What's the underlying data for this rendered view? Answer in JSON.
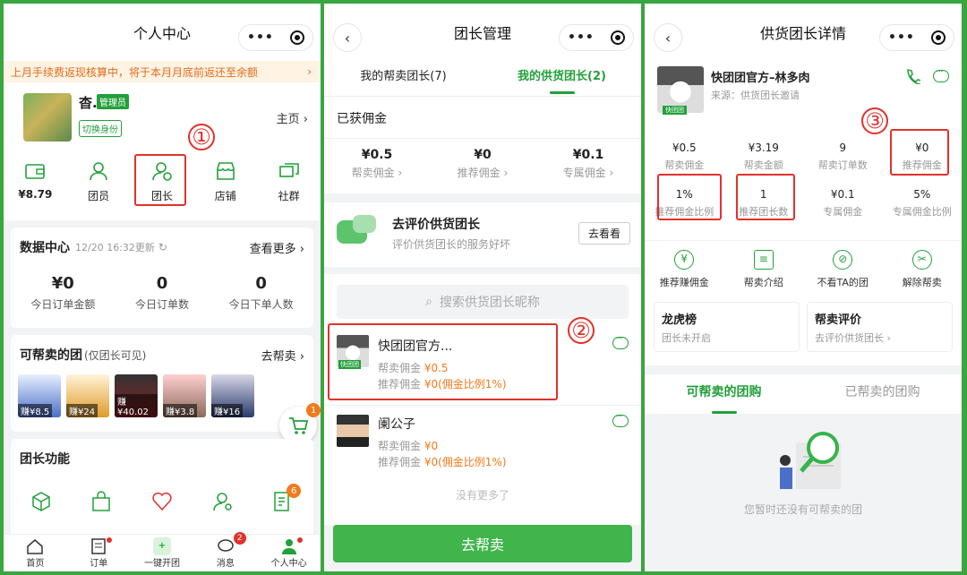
{
  "panel1": {
    "title": "个人中心",
    "notice": "上月手续费返现核算中，将于本月月底前返还至余额",
    "user": {
      "name": "杳.",
      "role": "管理员",
      "switch": "切换身份",
      "home": "主页"
    },
    "grid": [
      {
        "value": "¥8.79",
        "icon": "wallet-icon"
      },
      {
        "label": "团员",
        "icon": "person-icon"
      },
      {
        "label": "团长",
        "icon": "leader-icon"
      },
      {
        "label": "店铺",
        "icon": "shop-icon"
      },
      {
        "label": "社群",
        "icon": "group-chat-icon"
      }
    ],
    "marker": "①",
    "data_center": {
      "title": "数据中心",
      "updated": "12/20 16:32更新",
      "more": "查看更多",
      "stats": [
        {
          "value": "¥0",
          "label": "今日订单金额"
        },
        {
          "value": "0",
          "label": "今日订单数"
        },
        {
          "value": "0",
          "label": "今日下单人数"
        }
      ]
    },
    "helpsell": {
      "title": "可帮卖的团",
      "note": "(仅团长可见)",
      "link": "去帮卖",
      "goods": [
        "赚¥8.5",
        "赚¥24",
        "赚¥40.02",
        "赚¥3.8",
        "赚¥16"
      ],
      "cart_badge": "1"
    },
    "leader_funcs": {
      "title": "团长功能",
      "badge": "6"
    },
    "tabbar": [
      {
        "label": "首页"
      },
      {
        "label": "订单"
      },
      {
        "label": "一键开团"
      },
      {
        "label": "消息",
        "badge": "2"
      },
      {
        "label": "个人中心"
      }
    ]
  },
  "panel2": {
    "title": "团长管理",
    "tabs": [
      "我的帮卖团长(7)",
      "我的供货团长(2)"
    ],
    "earned_title": "已获佣金",
    "earned": [
      {
        "value": "¥0.5",
        "label": "帮卖佣金"
      },
      {
        "value": "¥0",
        "label": "推荐佣金"
      },
      {
        "value": "¥0.1",
        "label": "专属佣金"
      }
    ],
    "review": {
      "title": "去评价供货团长",
      "desc": "评价供货团长的服务好坏",
      "button": "去看看"
    },
    "search_placeholder": "搜索供货团长昵称",
    "leaders": [
      {
        "name": "快团团官方...",
        "badge": "快团团",
        "sell_label": "帮卖佣金",
        "sell": "¥0.5",
        "rec_label": "推荐佣金",
        "rec": "¥0(佣金比例1%)"
      },
      {
        "name": "阑公子",
        "sell_label": "帮卖佣金",
        "sell": "¥0",
        "rec_label": "推荐佣金",
        "rec": "¥0(佣金比例1%)"
      }
    ],
    "marker": "②",
    "no_more": "没有更多了",
    "main_button": "去帮卖"
  },
  "panel3": {
    "title": "供货团长详情",
    "leader": {
      "name": "快团团官方–林多肉",
      "source": "来源：供货团长邀请",
      "badge": "快团团"
    },
    "marker": "③",
    "stats": [
      {
        "value": "¥0.5",
        "label": "帮卖佣金"
      },
      {
        "value": "¥3.19",
        "label": "帮卖金额"
      },
      {
        "value": "9",
        "label": "帮卖订单数"
      },
      {
        "value": "¥0",
        "label": "推荐佣金"
      },
      {
        "value": "1%",
        "label": "推荐佣金比例"
      },
      {
        "value": "1",
        "label": "推荐团长数"
      },
      {
        "value": "¥0.1",
        "label": "专属佣金"
      },
      {
        "value": "5%",
        "label": "专属佣金比例"
      }
    ],
    "actions": [
      "推荐赚佣金",
      "帮卖介绍",
      "不看TA的团",
      "解除帮卖"
    ],
    "cards": [
      {
        "title": "龙虎榜",
        "desc": "团长未开启"
      },
      {
        "title": "帮卖评价",
        "desc": "去评价供货团长"
      }
    ],
    "tabs": [
      "可帮卖的团购",
      "已帮卖的团购"
    ],
    "empty": "您暂时还没有可帮卖的团"
  }
}
